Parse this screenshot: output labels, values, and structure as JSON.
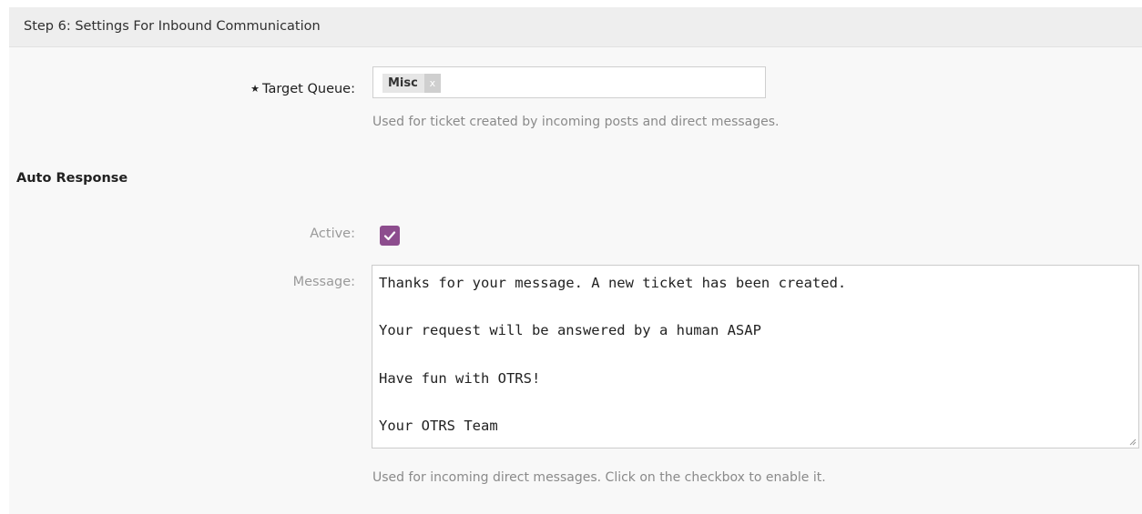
{
  "header": {
    "title": "Step 6: Settings For Inbound Communication"
  },
  "target_queue": {
    "required_marker": "★",
    "label": "Target Queue:",
    "selected_tag": "Misc",
    "remove_glyph": "x",
    "help": "Used for ticket created by incoming posts and direct messages."
  },
  "auto_response": {
    "section_title": "Auto Response",
    "active_label": "Active:",
    "active_checked": true,
    "message_label": "Message:",
    "message_lines": [
      "Thanks for your message. A new ticket has been created.",
      "Your request will be answered by a human ASAP",
      "Have fun with OTRS!",
      "Your OTRS Team"
    ],
    "help": "Used for incoming direct messages. Click on the checkbox to enable it."
  },
  "colors": {
    "accent": "#8d4d8e",
    "panel_background": "#f8f8f8",
    "header_background": "#eeeeee"
  }
}
